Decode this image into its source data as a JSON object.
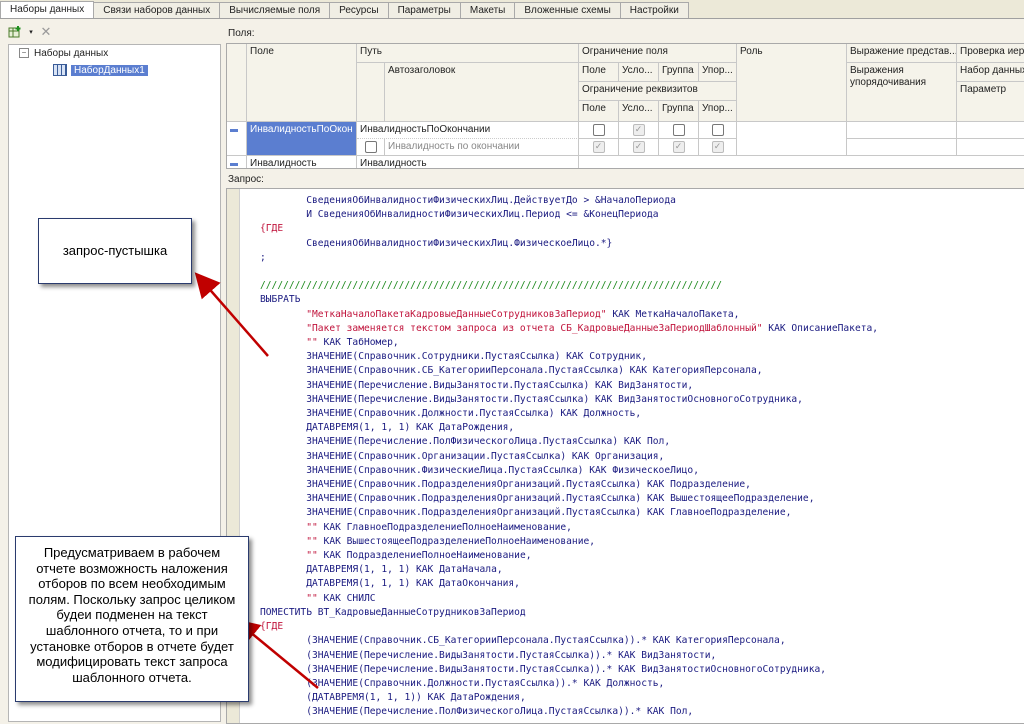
{
  "tabs": [
    {
      "label": "Наборы данных",
      "active": true
    },
    {
      "label": "Связи наборов данных",
      "active": false
    },
    {
      "label": "Вычисляемые поля",
      "active": false
    },
    {
      "label": "Ресурсы",
      "active": false
    },
    {
      "label": "Параметры",
      "active": false
    },
    {
      "label": "Макеты",
      "active": false
    },
    {
      "label": "Вложенные схемы",
      "active": false
    },
    {
      "label": "Настройки",
      "active": false
    }
  ],
  "tree": {
    "root": "Наборы данных",
    "child": "НаборДанных1"
  },
  "fields_label": "Поля:",
  "query_label": "Запрос:",
  "grid": {
    "headers": {
      "field": "Поле",
      "path": "Путь",
      "autotitle": "Автозаголовок",
      "restriction": "Ограничение поля",
      "field_sub": "Поле",
      "cond_sub": "Усло...",
      "group_sub": "Группа",
      "order_sub": "Упор...",
      "restriction_req": "Ограничение реквизитов",
      "role": "Роль",
      "expr_repr": "Выражение представ...",
      "expr_order": "Выражения упорядочивания",
      "check": "Проверка иер",
      "check_set": "Набор данных",
      "check_param": "Параметр"
    },
    "rows": [
      {
        "field": "ИнвалидностьПоОкон",
        "path": "ИнвалидностьПоОкончании",
        "title": "Инвалидность по окончании"
      },
      {
        "field": "Инвалидность",
        "path": "Инвалидность"
      }
    ]
  },
  "code_lines": [
    "        СведенияОбИнвалидностиФизическихЛиц.ДействуетДо > &НачалоПериода",
    "        И СведенияОбИнвалидностиФизическихЛиц.Период <= &КонецПериода",
    "{ГДЕ",
    "        СведенияОбИнвалидностиФизическихЛиц.ФизическоеЛицо.*}",
    ";",
    "",
    "////////////////////////////////////////////////////////////////////////////////",
    "ВЫБРАТЬ",
    "        \"МеткаНачалоПакетаКадровыеДанныеСотрудниковЗаПериод\" КАК МеткаНачалоПакета,",
    "        \"Пакет заменяется текстом запроса из отчета СБ_КадровыеДанныеЗаПериодШаблонный\" КАК ОписаниеПакета,",
    "        \"\" КАК ТабНомер,",
    "        ЗНАЧЕНИЕ(Справочник.Сотрудники.ПустаяСсылка) КАК Сотрудник,",
    "        ЗНАЧЕНИЕ(Справочник.СБ_КатегорииПерсонала.ПустаяСсылка) КАК КатегорияПерсонала,",
    "        ЗНАЧЕНИЕ(Перечисление.ВидыЗанятости.ПустаяСсылка) КАК ВидЗанятости,",
    "        ЗНАЧЕНИЕ(Перечисление.ВидыЗанятости.ПустаяСсылка) КАК ВидЗанятостиОсновногоСотрудника,",
    "        ЗНАЧЕНИЕ(Справочник.Должности.ПустаяСсылка) КАК Должность,",
    "        ДАТАВРЕМЯ(1, 1, 1) КАК ДатаРождения,",
    "        ЗНАЧЕНИЕ(Перечисление.ПолФизическогоЛица.ПустаяСсылка) КАК Пол,",
    "        ЗНАЧЕНИЕ(Справочник.Организации.ПустаяСсылка) КАК Организация,",
    "        ЗНАЧЕНИЕ(Справочник.ФизическиеЛица.ПустаяСсылка) КАК ФизическоеЛицо,",
    "        ЗНАЧЕНИЕ(Справочник.ПодразделенияОрганизаций.ПустаяСсылка) КАК Подразделение,",
    "        ЗНАЧЕНИЕ(Справочник.ПодразделенияОрганизаций.ПустаяСсылка) КАК ВышестоящееПодразделение,",
    "        ЗНАЧЕНИЕ(Справочник.ПодразделенияОрганизаций.ПустаяСсылка) КАК ГлавноеПодразделение,",
    "        \"\" КАК ГлавноеПодразделениеПолноеНаименование,",
    "        \"\" КАК ВышестоящееПодразделениеПолноеНаименование,",
    "        \"\" КАК ПодразделениеПолноеНаименование,",
    "        ДАТАВРЕМЯ(1, 1, 1) КАК ДатаНачала,",
    "        ДАТАВРЕМЯ(1, 1, 1) КАК ДатаОкончания,",
    "        \"\" КАК СНИЛС",
    "ПОМЕСТИТЬ ВТ_КадровыеДанныеСотрудниковЗаПериод",
    "{ГДЕ",
    "        (ЗНАЧЕНИЕ(Справочник.СБ_КатегорииПерсонала.ПустаяСсылка)).* КАК КатегорияПерсонала,",
    "        (ЗНАЧЕНИЕ(Перечисление.ВидыЗанятости.ПустаяСсылка)).* КАК ВидЗанятости,",
    "        (ЗНАЧЕНИЕ(Перечисление.ВидыЗанятости.ПустаяСсылка)).* КАК ВидЗанятостиОсновногоСотрудника,",
    "        (ЗНАЧЕНИЕ(Справочник.Должности.ПустаяСсылка)).* КАК Должность,",
    "        (ДАТАВРЕМЯ(1, 1, 1)) КАК ДатаРождения,",
    "        (ЗНАЧЕНИЕ(Перечисление.ПолФизическогоЛица.ПустаяСсылка)).* КАК Пол,"
  ],
  "callouts": {
    "empty_query": "запрос-пустышка",
    "explanation": "Предусматриваем в рабочем отчете возможность наложения отборов по всем необходимым полям. Поскольку запрос целиком будеи подменен на текст шаблонного отчета, то и при установке отборов в отчете будет модифицировать текст запроса шаблонного отчета."
  },
  "colors": {
    "keyword": "#c0143c",
    "identifier": "#1a1a80",
    "comment": "#1e8a1e",
    "selection": "#5b7ed0",
    "arrow": "#c00000"
  }
}
